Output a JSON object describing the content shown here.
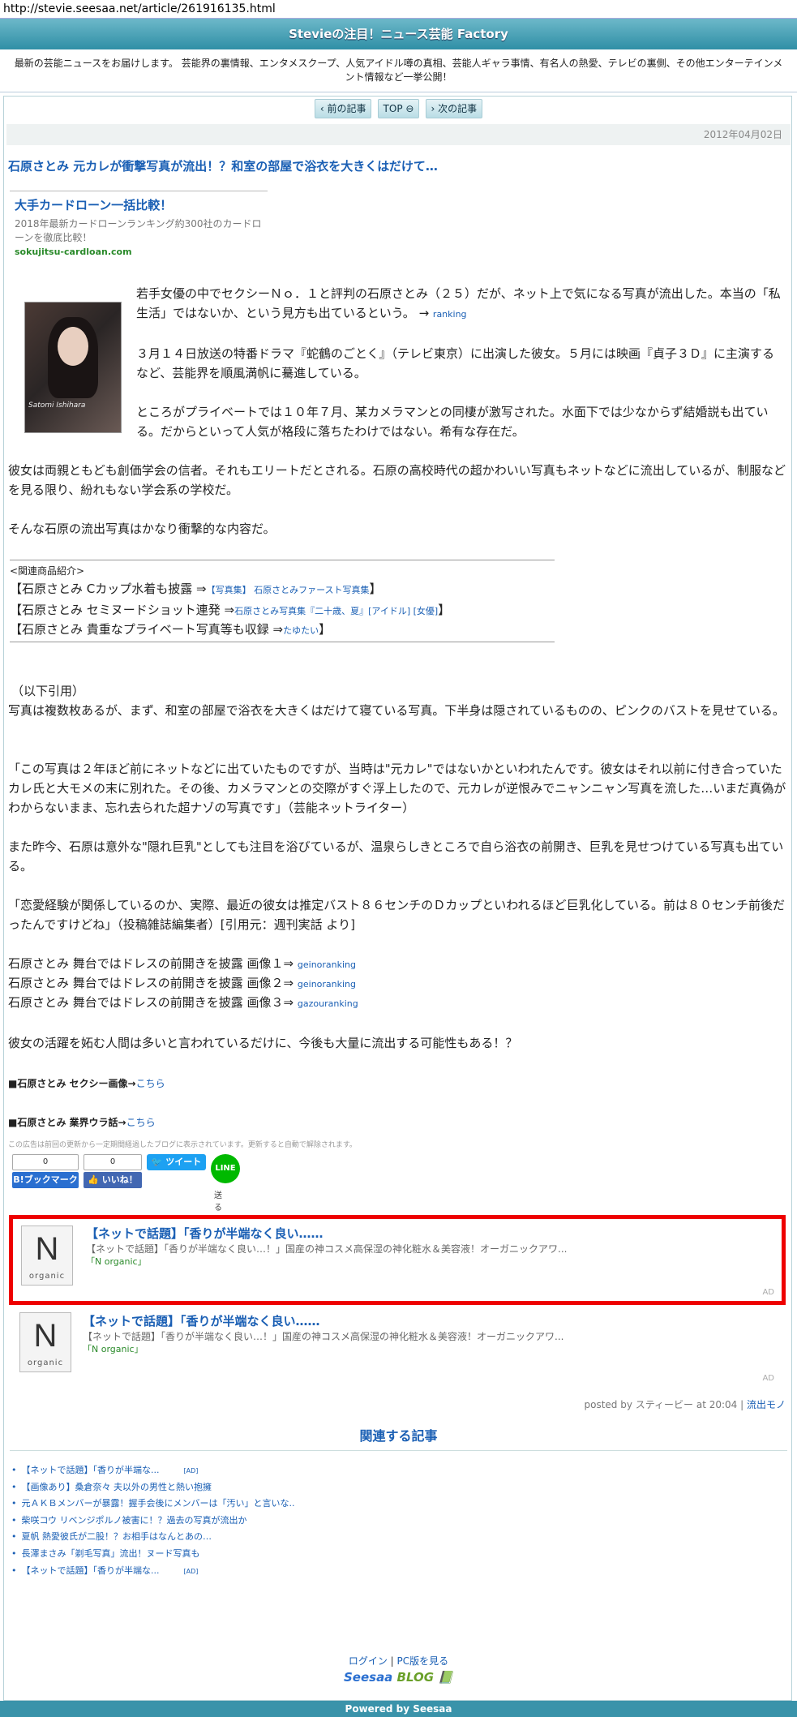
{
  "browser": {
    "url": "http://stevie.seesaa.net/article/261916135.html"
  },
  "header": {
    "title": "Stevieの注目！ニュース芸能 Factory",
    "description": "最新の芸能ニュースをお届けします。 芸能界の裏情報、エンタメスクープ、人気アイドル噂の真相、芸能人ギャラ事情、有名人の熱愛、テレビの裏側、その他エンターテインメント情報など一挙公開！"
  },
  "nav": {
    "prev": "前の記事",
    "top": "TOP",
    "next": "次の記事"
  },
  "article": {
    "date": "2012年04月02日",
    "title": "石原さとみ 元カレが衝撃写真が流出！？和室の部屋で浴衣を大きくはだけて…",
    "ad": {
      "title": "大手カードローン一括比較！",
      "desc": "2018年最新カードローンランキング約300社のカードローンを徹底比較！",
      "url": "sokujitsu-cardloan.com"
    },
    "photo_caption": "Satomi Ishihara",
    "p1a": "若手女優の中でセクシーＮｏ．１と評判の石原さとみ（２５）だが、ネット上で気になる写真が流出した。本当の「私生活」ではないか、という見方も出ているという。 →",
    "p1_link": "ranking",
    "p2": "３月１４日放送の特番ドラマ『蛇鶴のごとく』（テレビ東京）に出演した彼女。５月には映画『貞子３Ｄ』に主演するなど、芸能界を順風満帆に驀進している。",
    "p3": "ところがプライベートでは１０年７月、某カメラマンとの同棲が激写された。水面下では少なからず結婚説も出ている。だからといって人気が格段に落ちたわけではない。希有な存在だ。",
    "p4": "彼女は両親ともども創価学会の信者。それもエリートだとされる。石原の高校時代の超かわいい写真もネットなどに流出しているが、制服などを見る限り、紛れもない学会系の学校だ。",
    "p5": "そんな石原の流出写真はかなり衝撃的な内容だ。",
    "related_label": "<関連商品紹介>",
    "rel1_text": "【石原さとみ Cカップ水着も披露 ⇒",
    "rel1_link": "【写真集】 石原さとみファースト写真集",
    "rel1_end": "】",
    "rel2_text": "【石原さとみ セミヌードショット連発 ⇒",
    "rel2_link": "石原さとみ写真集『二十歳、夏』[アイドル] [女優]",
    "rel2_end": "】",
    "rel3_text": "【石原さとみ 貴重なプライベート写真等も収録 ⇒",
    "rel3_link": "たゆたい",
    "rel3_end": "】",
    "quote_label": "（以下引用）",
    "q1": "写真は複数枚あるが、まず、和室の部屋で浴衣を大きくはだけて寝ている写真。下半身は隠されているものの、ピンクのバストを見せている。",
    "q2": "「この写真は２年ほど前にネットなどに出ていたものですが、当時は\"元カレ\"ではないかといわれたんです。彼女はそれ以前に付き合っていたカレ氏と大モメの末に別れた。その後、カメラマンとの交際がすぐ浮上したので、元カレが逆恨みでニャンニャン写真を流した…いまだ真偽がわからないまま、忘れ去られた超ナゾの写真です」（芸能ネットライター）",
    "q3": "また昨今、石原は意外な\"隠れ巨乳\"としても注目を浴びているが、温泉らしきところで自ら浴衣の前開き、巨乳を見せつけている写真も出ている。",
    "q4": "「恋愛経験が関係しているのか、実際、最近の彼女は推定バスト８６センチのＤカップといわれるほど巨乳化している。前は８０センチ前後だったんですけどね」（投稿雑誌編集者）[引用元：週刊実話 より]",
    "img1": "石原さとみ 舞台ではドレスの前開きを披露 画像１⇒",
    "img1_link": "geinoranking",
    "img2": "石原さとみ 舞台ではドレスの前開きを披露 画像２⇒",
    "img2_link": "geinoranking",
    "img3": "石原さとみ 舞台ではドレスの前開きを披露 画像３⇒",
    "img3_link": "gazouranking",
    "p6": "彼女の活躍を妬む人間は多いと言われているだけに、今後も大量に流出する可能性もある！？",
    "sexy": "■石原さとみ セクシー画像→",
    "sexy_link": "こちら",
    "ura": "■石原さとみ 業界ウラ話→",
    "ura_link": "こちら",
    "ad_notice": "この広告は前回の更新から一定期間経過したブログに表示されています。更新すると自動で解除されます。"
  },
  "share": {
    "hatena_count": "0",
    "hatena_label": "B!ブックマーク",
    "fb_count": "0",
    "fb_label": "いいね！",
    "tweet_label": "ツイート",
    "line_label": "LINE",
    "line_send": "送る"
  },
  "native_ads": [
    {
      "title": "【ネットで話題】「香りが半端なく良い……",
      "desc": "【ネットで話題】「香りが半端なく良い…！」国産の神コスメ高保湿の神化粧水＆美容液！オーガニックアワ...",
      "source": "「N organic」",
      "ad": "AD",
      "logo": "N",
      "logo_sub": "organic"
    },
    {
      "title": "【ネットで話題】「香りが半端なく良い……",
      "desc": "【ネットで話題】「香りが半端なく良い…！」国産の神コスメ高保湿の神化粧水＆美容液！オーガニックアワ...",
      "source": "「N organic」",
      "ad": "AD",
      "logo": "N",
      "logo_sub": "organic"
    }
  ],
  "posted": {
    "text": "posted by スティービー at 20:04 |",
    "link": "流出モノ"
  },
  "related": {
    "heading": "関連する記事",
    "items": [
      {
        "text": "【ネットで話題】「香りが半端な...",
        "ad": "[AD]"
      },
      {
        "text": "【画像あり】桑倉奈々 夫以外の男性と熱い抱擁",
        "ad": ""
      },
      {
        "text": "元ＡＫＢメンバーが暴露！握手会後にメンバーは「汚い」と言いな..",
        "ad": ""
      },
      {
        "text": "柴咲コウ リベンジポルノ被害に！？過去の写真が流出か",
        "ad": ""
      },
      {
        "text": "夏帆 熱愛彼氏が二股！？お相手はなんとあの…",
        "ad": ""
      },
      {
        "text": "長澤まさみ「剃毛写真」流出！ヌード写真も",
        "ad": ""
      },
      {
        "text": "【ネットで話題】「香りが半端な...",
        "ad": "[AD]"
      }
    ]
  },
  "footer": {
    "login": "ログイン",
    "pc": "PC版を見る",
    "seesaa": "Seesaa",
    "blog": "BLOG",
    "powered": "Powered by Seesaa"
  }
}
